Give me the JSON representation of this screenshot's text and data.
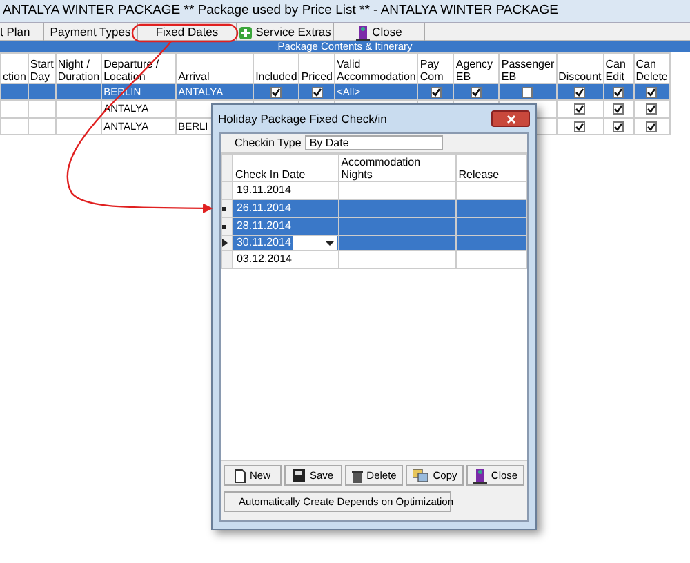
{
  "window": {
    "title": "ANTALYA WINTER PACKAGE ** Package used by Price List ** - ANTALYA WINTER PACKAGE"
  },
  "toolbar": [
    {
      "label": "t Plan",
      "kind": "plain"
    },
    {
      "label": "Payment Types",
      "kind": "plain"
    },
    {
      "label": "Fixed Dates",
      "kind": "plain"
    },
    {
      "label": "Service Extras",
      "kind": "plus"
    },
    {
      "label": "Close",
      "kind": "door"
    }
  ],
  "section_title": "Package Contents & Itinerary",
  "grid": {
    "columns": [
      {
        "label": "ction",
        "kind": "text"
      },
      {
        "label": "Start Day",
        "kind": "text"
      },
      {
        "label": "Night / Duration",
        "kind": "text"
      },
      {
        "label": "Departure / Location",
        "kind": "text"
      },
      {
        "label": "Arrival",
        "kind": "text"
      },
      {
        "label": "Included",
        "kind": "check"
      },
      {
        "label": "Priced",
        "kind": "check"
      },
      {
        "label": "Valid Accommodation",
        "kind": "text"
      },
      {
        "label": "Pay Com",
        "kind": "check"
      },
      {
        "label": "Agency EB",
        "kind": "check"
      },
      {
        "label": "Passenger EB",
        "kind": "check"
      },
      {
        "label": "Discount",
        "kind": "check"
      },
      {
        "label": "Can Edit",
        "kind": "check"
      },
      {
        "label": "Can Delete",
        "kind": "check"
      }
    ],
    "rows": [
      {
        "selected": true,
        "cells": [
          null,
          null,
          null,
          "BERLIN",
          "ANTALYA",
          true,
          true,
          "<All>",
          true,
          true,
          false,
          true,
          true,
          true
        ]
      },
      {
        "selected": false,
        "cells": [
          null,
          null,
          null,
          "ANTALYA",
          null,
          null,
          null,
          null,
          null,
          null,
          null,
          true,
          true,
          true
        ]
      },
      {
        "selected": false,
        "cells": [
          null,
          null,
          null,
          "ANTALYA",
          "BERLI",
          null,
          null,
          null,
          null,
          null,
          null,
          true,
          true,
          true
        ]
      }
    ]
  },
  "dialog": {
    "title": "Holiday Package Fixed  Check/in",
    "checkin_type_label": "Checkin Type",
    "checkin_type": "By Date",
    "columns": [
      "Check In Date",
      "Accommodation Nights",
      "Release"
    ],
    "rows": [
      {
        "check_in_date": "19.11.2014",
        "selected": false,
        "current": false
      },
      {
        "check_in_date": "26.11.2014",
        "selected": true,
        "current": false
      },
      {
        "check_in_date": "28.11.2014",
        "selected": true,
        "current": false
      },
      {
        "check_in_date": "30.11.2014",
        "selected": true,
        "current": true
      },
      {
        "check_in_date": "03.12.2014",
        "selected": false,
        "current": false
      }
    ],
    "buttons": [
      {
        "label": "New",
        "kind": "page"
      },
      {
        "label": "Save",
        "kind": "disk"
      },
      {
        "label": "Delete",
        "kind": "bin"
      },
      {
        "label": "Copy",
        "kind": "copy"
      },
      {
        "label": "Close",
        "kind": "door"
      }
    ],
    "auto_button": "Automatically Create Depends on Optimization"
  }
}
